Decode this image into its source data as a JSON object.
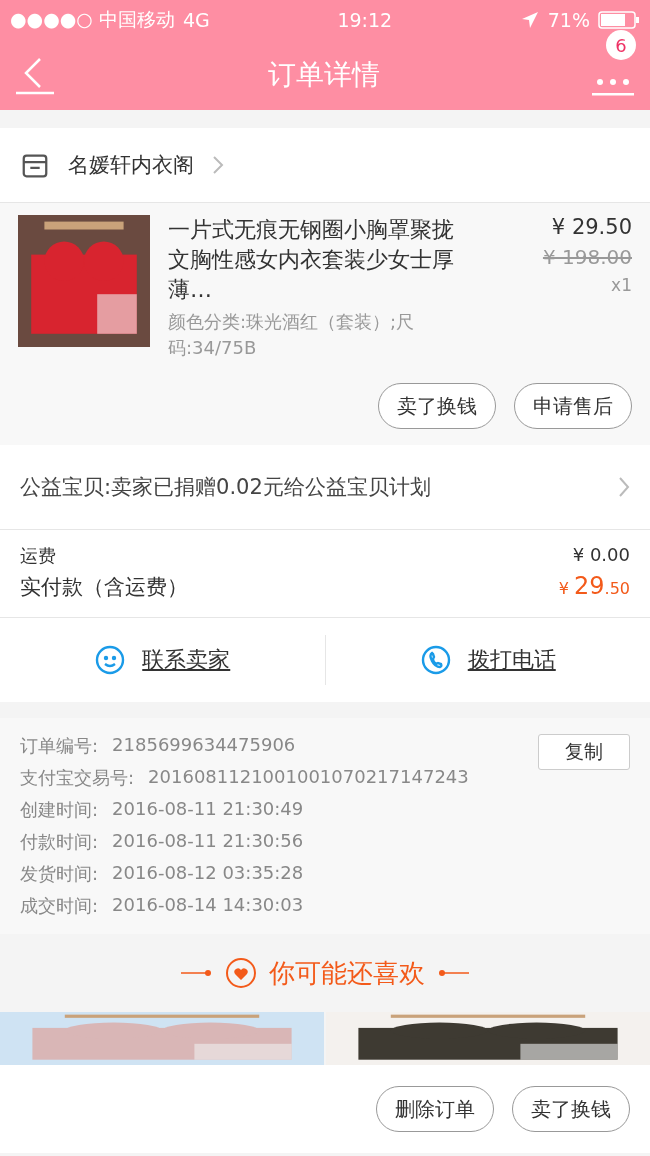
{
  "status_bar": {
    "carrier": "●●●●○ 中国移动",
    "network": "4G",
    "time": "19:12",
    "battery": "71%"
  },
  "nav": {
    "title": "订单详情",
    "badge": "6"
  },
  "shop": {
    "name": "名媛轩内衣阁"
  },
  "product": {
    "kind": "picture",
    "title": "一片式无痕无钢圈小胸罩聚拢文胸性感女内衣套装少女士厚薄…",
    "spec": "颜色分类:珠光酒红（套装）;尺码:34/75B",
    "price": "¥ 29.50",
    "original_price": "¥ 198.00",
    "quantity": "x1",
    "buttons": [
      "卖了换钱",
      "申请售后"
    ]
  },
  "charity": "公益宝贝:卖家已捐赠0.02元给公益宝贝计划",
  "fees": [
    {
      "label": "运费",
      "value": "¥ 0.00"
    }
  ],
  "paid": {
    "label": "实付款（含运费）",
    "currency": "¥",
    "integer": "29",
    "decimal": ".50"
  },
  "contact": [
    {
      "kind": "chat",
      "label": "联系卖家"
    },
    {
      "kind": "phone",
      "label": "拨打电话"
    }
  ],
  "order_info": [
    {
      "label": "订单编号:",
      "value": "2185699634475906"
    },
    {
      "label": "支付宝交易号:",
      "value": "2016081121001001070217147243"
    },
    {
      "label": "创建时间:",
      "value": "2016-08-11 21:30:49"
    },
    {
      "label": "付款时间:",
      "value": "2016-08-11 21:30:56"
    },
    {
      "label": "发货时间:",
      "value": "2016-08-12 03:35:28"
    },
    {
      "label": "成交时间:",
      "value": "2016-08-14 14:30:03"
    }
  ],
  "copy_button": "复制",
  "recommend": {
    "title": "你可能还喜欢"
  },
  "bottom_buttons": [
    "删除订单",
    "卖了换钱"
  ]
}
